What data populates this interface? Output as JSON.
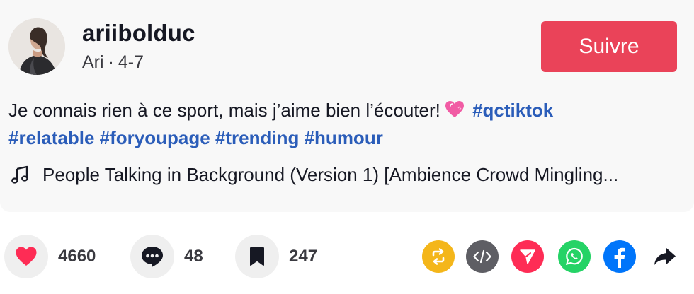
{
  "post": {
    "username": "ariibolduc",
    "display_name": "Ari",
    "separator": "·",
    "date": "4-7",
    "follow_label": "Suivre",
    "description_text": "Je connais rien à ce sport, mais j’aime bien l’écouter!",
    "description_emoji": "💗",
    "hashtags": [
      "#qctiktok",
      "#relatable",
      "#foryoupage",
      "#trending",
      "#humour"
    ],
    "music_title": "People Talking in Background (Version 1) [Ambience Crowd Mingling..."
  },
  "stats": {
    "likes": "4660",
    "comments": "48",
    "saves": "247"
  },
  "colors": {
    "follow": "#ea4359",
    "hashtag": "#2b5db9",
    "like_heart": "#fe2c55",
    "repost": "#f4b61a",
    "embed": "#5e5e64",
    "send": "#fe2c55",
    "whatsapp": "#25d366",
    "facebook": "#0075fa"
  },
  "icons": {
    "avatar": "profile-photo",
    "music": "music-note-icon",
    "like": "heart-icon",
    "comment": "comment-bubble-icon",
    "save": "bookmark-icon",
    "share_buttons": [
      "repost-icon",
      "embed-code-icon",
      "send-to-friends-icon",
      "whatsapp-icon",
      "facebook-icon",
      "share-arrow-icon"
    ]
  }
}
